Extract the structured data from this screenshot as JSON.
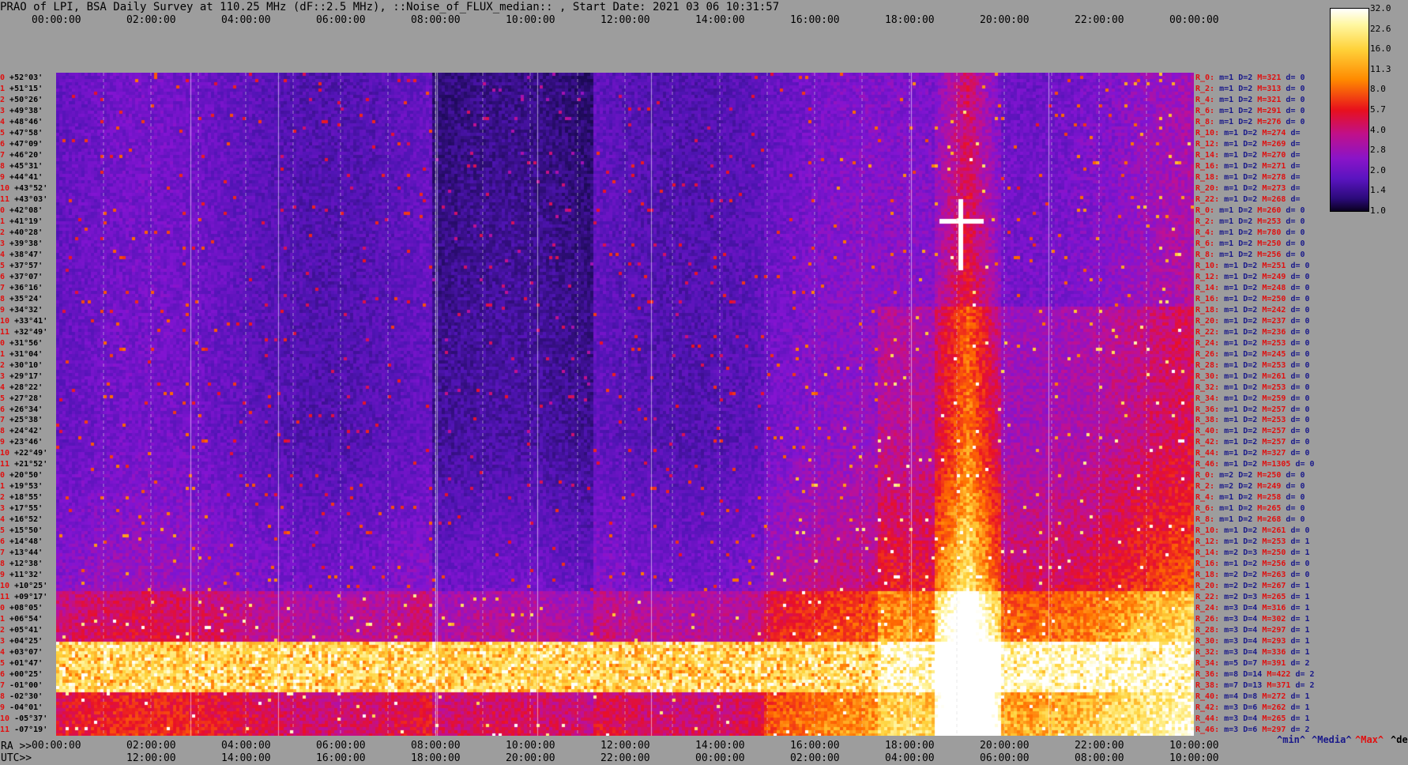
{
  "title": "PRAO of LPI, BSA Daily Survey at 110.25 MHz (dF::2.5 MHz), ::Noise_of_FLUX_median:: , Start Date: 2021 03 06 10:31:57",
  "top_axis": [
    "00:00:00",
    "02:00:00",
    "04:00:00",
    "06:00:00",
    "08:00:00",
    "10:00:00",
    "12:00:00",
    "14:00:00",
    "16:00:00",
    "18:00:00",
    "20:00:00",
    "22:00:00",
    "00:00:00"
  ],
  "ra_axis_prefix": "RA >>",
  "ra_axis": [
    "00:00:00",
    "02:00:00",
    "04:00:00",
    "06:00:00",
    "08:00:00",
    "10:00:00",
    "12:00:00",
    "14:00:00",
    "16:00:00",
    "18:00:00",
    "20:00:00",
    "22:00:00",
    "10:00:00"
  ],
  "utc_prefix": "UTC>>",
  "utc_axis": [
    "12:00:00",
    "14:00:00",
    "16:00:00",
    "18:00:00",
    "20:00:00",
    "22:00:00",
    "00:00:00",
    "02:00:00",
    "04:00:00",
    "06:00:00",
    "08:00:00",
    "10:00:00"
  ],
  "colorbar_ticks": [
    "32.0",
    "22.6",
    "16.0",
    "11.3",
    "8.0",
    "5.7",
    "4.0",
    "2.8",
    "2.0",
    "1.4",
    "1.0"
  ],
  "legend_bottom": {
    "min": "^min^",
    "median": "^Media^",
    "max": "^Max^",
    "devia": "^devia^"
  },
  "colors": {
    "low": "#1a0a46",
    "mid": "#7a18d0",
    "high": "#e8101c",
    "peak": "#ffffff",
    "background": "#9d9d9d",
    "label_red": "#e01010",
    "label_blue": "#1a1a8a"
  },
  "chart_data": {
    "type": "heatmap",
    "title": "PRAO of LPI, BSA Daily Survey at 110.25 MHz (dF::2.5 MHz), ::Noise_of_FLUX_median:: , Start Date: 2021 03 06 10:31:57",
    "x_ticks_top": [
      "00:00:00",
      "02:00:00",
      "04:00:00",
      "06:00:00",
      "08:00:00",
      "10:00:00",
      "12:00:00",
      "14:00:00",
      "16:00:00",
      "18:00:00",
      "20:00:00",
      "22:00:00",
      "00:00:00"
    ],
    "x_ticks_ra": [
      "00:00:00",
      "02:00:00",
      "04:00:00",
      "06:00:00",
      "08:00:00",
      "10:00:00",
      "12:00:00",
      "14:00:00",
      "16:00:00",
      "18:00:00",
      "20:00:00",
      "22:00:00",
      "10:00:00"
    ],
    "x_ticks_utc": [
      "12:00:00",
      "14:00:00",
      "16:00:00",
      "18:00:00",
      "20:00:00",
      "22:00:00",
      "00:00:00",
      "02:00:00",
      "04:00:00",
      "06:00:00",
      "08:00:00",
      "10:00:00"
    ],
    "colorbar": {
      "ticks": [
        32.0,
        22.6,
        16.0,
        11.3,
        8.0,
        5.7,
        4.0,
        2.8,
        2.0,
        1.4,
        1.0
      ],
      "scale": "log"
    },
    "rows": [
      {
        "idx": "0",
        "dec": "+52°03'",
        "ray": "R_0:",
        "m": "m=1",
        "D": "D=2",
        "M": "M=321",
        "d": "d= 0"
      },
      {
        "idx": "1",
        "dec": "+51°15'",
        "ray": "R_2:",
        "m": "m=1",
        "D": "D=2",
        "M": "M=313",
        "d": "d= 0"
      },
      {
        "idx": "2",
        "dec": "+50°26'",
        "ray": "R_4:",
        "m": "m=1",
        "D": "D=2",
        "M": "M=321",
        "d": "d= 0"
      },
      {
        "idx": "3",
        "dec": "+49°38'",
        "ray": "R_6:",
        "m": "m=1",
        "D": "D=2",
        "M": "M=291",
        "d": "d= 0"
      },
      {
        "idx": "4",
        "dec": "+48°46'",
        "ray": "R_8:",
        "m": "m=1",
        "D": "D=2",
        "M": "M=276",
        "d": "d= 0"
      },
      {
        "idx": "5",
        "dec": "+47°58'",
        "ray": "R_10:",
        "m": "m=1",
        "D": "D=2",
        "M": "M=274",
        "d": "d="
      },
      {
        "idx": "6",
        "dec": "+47°09'",
        "ray": "R_12:",
        "m": "m=1",
        "D": "D=2",
        "M": "M=269",
        "d": "d="
      },
      {
        "idx": "7",
        "dec": "+46°20'",
        "ray": "R_14:",
        "m": "m=1",
        "D": "D=2",
        "M": "M=270",
        "d": "d="
      },
      {
        "idx": "8",
        "dec": "+45°31'",
        "ray": "R_16:",
        "m": "m=1",
        "D": "D=2",
        "M": "M=271",
        "d": "d="
      },
      {
        "idx": "9",
        "dec": "+44°41'",
        "ray": "R_18:",
        "m": "m=1",
        "D": "D=2",
        "M": "M=278",
        "d": "d="
      },
      {
        "idx": "10",
        "dec": "+43°52'",
        "ray": "R_20:",
        "m": "m=1",
        "D": "D=2",
        "M": "M=273",
        "d": "d="
      },
      {
        "idx": "11",
        "dec": "+43°03'",
        "ray": "R_22:",
        "m": "m=1",
        "D": "D=2",
        "M": "M=268",
        "d": "d="
      },
      {
        "idx": "12",
        "dec": "+42°08'",
        "ray": "R_0:",
        "m": "m=1",
        "D": "D=2",
        "M": "M=260",
        "d": "d= 0"
      },
      {
        "idx": "13",
        "dec": "+41°19'",
        "ray": "R_2:",
        "m": "m=1",
        "D": "D=2",
        "M": "M=253",
        "d": "d= 0"
      },
      {
        "idx": "14",
        "dec": "+40°28'",
        "ray": "R_4:",
        "m": "m=1",
        "D": "D=2",
        "M": "M=780",
        "d": "d= 0"
      },
      {
        "idx": "15",
        "dec": "+39°38'",
        "ray": "R_6:",
        "m": "m=1",
        "D": "D=2",
        "M": "M=250",
        "d": "d= 0"
      },
      {
        "idx": "16",
        "dec": "+38°47'",
        "ray": "R_8:",
        "m": "m=1",
        "D": "D=2",
        "M": "M=256",
        "d": "d= 0"
      },
      {
        "idx": "17",
        "dec": "+37°57'",
        "ray": "R_10:",
        "m": "m=1",
        "D": "D=2",
        "M": "M=251",
        "d": "d= 0"
      },
      {
        "idx": "18",
        "dec": "+37°07'",
        "ray": "R_12:",
        "m": "m=1",
        "D": "D=2",
        "M": "M=249",
        "d": "d= 0"
      },
      {
        "idx": "19",
        "dec": "+36°16'",
        "ray": "R_14:",
        "m": "m=1",
        "D": "D=2",
        "M": "M=248",
        "d": "d= 0"
      },
      {
        "idx": "20",
        "dec": "+35°24'",
        "ray": "R_16:",
        "m": "m=1",
        "D": "D=2",
        "M": "M=250",
        "d": "d= 0"
      },
      {
        "idx": "21",
        "dec": "+34°32'",
        "ray": "R_18:",
        "m": "m=1",
        "D": "D=2",
        "M": "M=242",
        "d": "d= 0"
      },
      {
        "idx": "22",
        "dec": "+33°41'",
        "ray": "R_20:",
        "m": "m=1",
        "D": "D=2",
        "M": "M=237",
        "d": "d= 0"
      },
      {
        "idx": "23",
        "dec": "+32°49'",
        "ray": "R_22:",
        "m": "m=1",
        "D": "D=2",
        "M": "M=236",
        "d": "d= 0"
      },
      {
        "idx": "24",
        "dec": "+31°56'",
        "ray": "R_24:",
        "m": "m=1",
        "D": "D=2",
        "M": "M=253",
        "d": "d= 0"
      },
      {
        "idx": "25",
        "dec": "+31°04'",
        "ray": "R_26:",
        "m": "m=1",
        "D": "D=2",
        "M": "M=245",
        "d": "d= 0"
      },
      {
        "idx": "26",
        "dec": "+30°10'",
        "ray": "R_28:",
        "m": "m=1",
        "D": "D=2",
        "M": "M=253",
        "d": "d= 0"
      },
      {
        "idx": "27",
        "dec": "+29°17'",
        "ray": "R_30:",
        "m": "m=1",
        "D": "D=2",
        "M": "M=261",
        "d": "d= 0"
      },
      {
        "idx": "28",
        "dec": "+28°22'",
        "ray": "R_32:",
        "m": "m=1",
        "D": "D=2",
        "M": "M=253",
        "d": "d= 0"
      },
      {
        "idx": "29",
        "dec": "+27°28'",
        "ray": "R_34:",
        "m": "m=1",
        "D": "D=2",
        "M": "M=259",
        "d": "d= 0"
      },
      {
        "idx": "30",
        "dec": "+26°34'",
        "ray": "R_36:",
        "m": "m=1",
        "D": "D=2",
        "M": "M=257",
        "d": "d= 0"
      },
      {
        "idx": "31",
        "dec": "+25°38'",
        "ray": "R_38:",
        "m": "m=1",
        "D": "D=2",
        "M": "M=253",
        "d": "d= 0"
      },
      {
        "idx": "32",
        "dec": "+24°42'",
        "ray": "R_40:",
        "m": "m=1",
        "D": "D=2",
        "M": "M=257",
        "d": "d= 0"
      },
      {
        "idx": "33",
        "dec": "+23°46'",
        "ray": "R_42:",
        "m": "m=1",
        "D": "D=2",
        "M": "M=257",
        "d": "d= 0"
      },
      {
        "idx": "34",
        "dec": "+22°49'",
        "ray": "R_44:",
        "m": "m=1",
        "D": "D=2",
        "M": "M=327",
        "d": "d= 0"
      },
      {
        "idx": "35",
        "dec": "+21°52'",
        "ray": "R_46:",
        "m": "m=1",
        "D": "D=2",
        "M": "M=1305",
        "d": "d= 0"
      },
      {
        "idx": "36",
        "dec": "+20°50'",
        "ray": "R_0:",
        "m": "m=2",
        "D": "D=2",
        "M": "M=250",
        "d": "d= 0"
      },
      {
        "idx": "37",
        "dec": "+19°53'",
        "ray": "R_2:",
        "m": "m=2",
        "D": "D=2",
        "M": "M=249",
        "d": "d= 0"
      },
      {
        "idx": "38",
        "dec": "+18°55'",
        "ray": "R_4:",
        "m": "m=1",
        "D": "D=2",
        "M": "M=258",
        "d": "d= 0"
      },
      {
        "idx": "39",
        "dec": "+17°55'",
        "ray": "R_6:",
        "m": "m=1",
        "D": "D=2",
        "M": "M=265",
        "d": "d= 0"
      },
      {
        "idx": "40",
        "dec": "+16°52'",
        "ray": "R_8:",
        "m": "m=1",
        "D": "D=2",
        "M": "M=268",
        "d": "d= 0"
      },
      {
        "idx": "41",
        "dec": "+15°50'",
        "ray": "R_10:",
        "m": "m=1",
        "D": "D=2",
        "M": "M=261",
        "d": "d= 0"
      },
      {
        "idx": "42",
        "dec": "+14°48'",
        "ray": "R_12:",
        "m": "m=1",
        "D": "D=2",
        "M": "M=253",
        "d": "d= 1"
      },
      {
        "idx": "43",
        "dec": "+13°44'",
        "ray": "R_14:",
        "m": "m=2",
        "D": "D=3",
        "M": "M=250",
        "d": "d= 1"
      },
      {
        "idx": "44",
        "dec": "+12°38'",
        "ray": "R_16:",
        "m": "m=1",
        "D": "D=2",
        "M": "M=256",
        "d": "d= 0"
      },
      {
        "idx": "45",
        "dec": "+11°32'",
        "ray": "R_18:",
        "m": "m=2",
        "D": "D=2",
        "M": "M=263",
        "d": "d= 0"
      },
      {
        "idx": "46",
        "dec": "+10°25'",
        "ray": "R_20:",
        "m": "m=2",
        "D": "D=2",
        "M": "M=267",
        "d": "d= 1"
      },
      {
        "idx": "47",
        "dec": "+09°17'",
        "ray": "R_22:",
        "m": "m=2",
        "D": "D=3",
        "M": "M=265",
        "d": "d= 1"
      },
      {
        "idx": "48",
        "dec": "+08°05'",
        "ray": "R_24:",
        "m": "m=3",
        "D": "D=4",
        "M": "M=316",
        "d": "d= 1"
      },
      {
        "idx": "49",
        "dec": "+06°54'",
        "ray": "R_26:",
        "m": "m=3",
        "D": "D=4",
        "M": "M=302",
        "d": "d= 1"
      },
      {
        "idx": "50",
        "dec": "+05°41'",
        "ray": "R_28:",
        "m": "m=3",
        "D": "D=4",
        "M": "M=297",
        "d": "d= 1"
      },
      {
        "idx": "51",
        "dec": "+04°25'",
        "ray": "R_30:",
        "m": "m=3",
        "D": "D=4",
        "M": "M=293",
        "d": "d= 1"
      },
      {
        "idx": "52",
        "dec": "+03°07'",
        "ray": "R_32:",
        "m": "m=3",
        "D": "D=4",
        "M": "M=336",
        "d": "d= 1"
      },
      {
        "idx": "53",
        "dec": "+01°47'",
        "ray": "R_34:",
        "m": "m=5",
        "D": "D=7",
        "M": "M=391",
        "d": "d= 2"
      },
      {
        "idx": "54",
        "dec": "+00°25'",
        "ray": "R_36:",
        "m": "m=8",
        "D": "D=14",
        "M": "M=422",
        "d": "d= 2"
      },
      {
        "idx": "55",
        "dec": "-01°00'",
        "ray": "R_38:",
        "m": "m=7",
        "D": "D=13",
        "M": "M=371",
        "d": "d= 2"
      },
      {
        "idx": "56",
        "dec": "-02°30'",
        "ray": "R_40:",
        "m": "m=4",
        "D": "D=8",
        "M": "M=272",
        "d": "d= 1"
      },
      {
        "idx": "57",
        "dec": "-04°01'",
        "ray": "R_42:",
        "m": "m=3",
        "D": "D=6",
        "M": "M=262",
        "d": "d= 1"
      },
      {
        "idx": "58",
        "dec": "-05°37'",
        "ray": "R_44:",
        "m": "m=3",
        "D": "D=4",
        "M": "M=265",
        "d": "d= 1"
      },
      {
        "idx": "59",
        "dec": "-07°19'",
        "ray": "R_46:",
        "m": "m=3",
        "D": "D=6",
        "M": "M=297",
        "d": "d= 2"
      }
    ]
  }
}
